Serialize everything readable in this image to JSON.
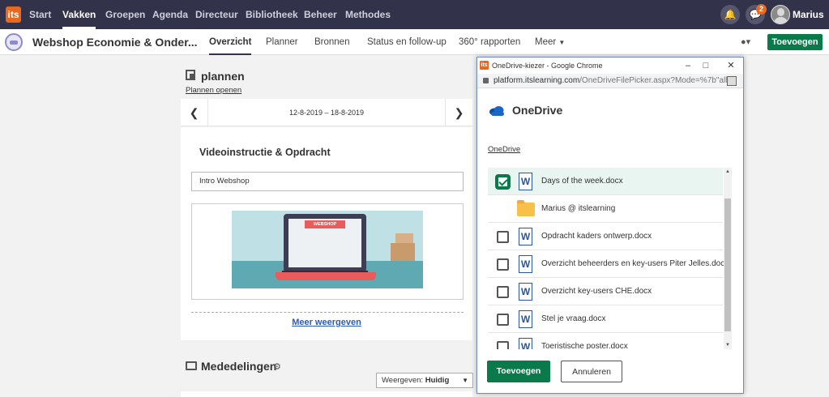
{
  "topbar": {
    "logo": "its",
    "nav": [
      "Start",
      "Vakken",
      "Groepen",
      "Agenda",
      "Directeur",
      "Bibliotheek",
      "Beheer",
      "Methodes"
    ],
    "active_nav": "Vakken",
    "notification_count": "2",
    "user_name": "Marius"
  },
  "course": {
    "title": "Webshop Economie & Onder...",
    "tabs": [
      "Overzicht",
      "Planner",
      "Bronnen",
      "Status en follow-up",
      "360° rapporten",
      "Meer"
    ],
    "active_tab": "Overzicht",
    "add_button": "Toevoegen"
  },
  "plans": {
    "heading": "plannen",
    "open_link": "Plannen openen",
    "date_range": "12-8-2019 – 18-8-2019",
    "item_title": "Videoinstructie & Opdracht",
    "input_value": "Intro Webshop",
    "illustration_label": "WEBSHOP",
    "more_link": "Meer weergeven"
  },
  "announcements": {
    "heading": "Mededelingen",
    "view_label": "Weergeven:",
    "view_value": "Huidig"
  },
  "popup": {
    "window_title": "OneDrive-kiezer - Google Chrome",
    "url_main": "platform.itslearning.com",
    "url_rest": "/OneDriveFilePicker.aspx?Mode=%7b\"all...",
    "service_title": "OneDrive",
    "breadcrumb": "OneDrive",
    "files": [
      {
        "name": "Days of the week.docx",
        "type": "word",
        "checked": true
      },
      {
        "name": "Marius @ itslearning",
        "type": "folder",
        "checked": false
      },
      {
        "name": "Opdracht kaders ontwerp.docx",
        "type": "word",
        "checked": false
      },
      {
        "name": "Overzicht beheerders en key-users Piter Jelles.docx",
        "type": "word",
        "checked": false
      },
      {
        "name": "Overzicht key-users CHE.docx",
        "type": "word",
        "checked": false
      },
      {
        "name": "Stel je vraag.docx",
        "type": "word",
        "checked": false
      },
      {
        "name": "Toeristische poster.docx",
        "type": "word",
        "checked": false
      }
    ],
    "ok_button": "Toevoegen",
    "cancel_button": "Annuleren"
  },
  "colors": {
    "accent_green": "#0b7a4b",
    "topbar": "#32324a",
    "brand_orange": "#e8691e"
  }
}
